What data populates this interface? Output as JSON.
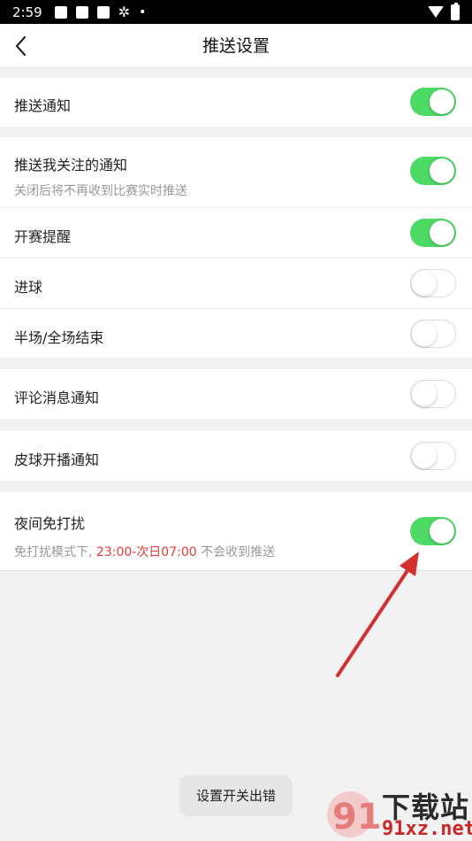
{
  "status_bar": {
    "time": "2:59",
    "dot": "•"
  },
  "header": {
    "title": "推送设置"
  },
  "sections": {
    "push": {
      "label": "推送通知",
      "on": true
    },
    "followed": {
      "label": "推送我关注的通知",
      "sub": "关闭后将不再收到比赛实时推送",
      "on": true
    },
    "kickoff": {
      "label": "开赛提醒",
      "on": true
    },
    "goal": {
      "label": "进球",
      "on": false
    },
    "halftime": {
      "label": "半场/全场结束",
      "on": false
    },
    "comment": {
      "label": "评论消息通知",
      "on": false
    },
    "pichu": {
      "label": "皮球开播通知",
      "on": false
    },
    "night": {
      "label": "夜间免打扰",
      "sub_prefix": "免打扰模式下, ",
      "sub_highlight": "23:00-次日07:00",
      "sub_suffix": " 不会收到推送",
      "on": true
    }
  },
  "toast": {
    "text": "设置开关出错"
  },
  "watermark": {
    "brand": "下载站",
    "url": "91xz.net"
  },
  "colors": {
    "toggle_on": "#4cd964",
    "highlight": "#e53935",
    "arrow": "#d32f2f"
  }
}
